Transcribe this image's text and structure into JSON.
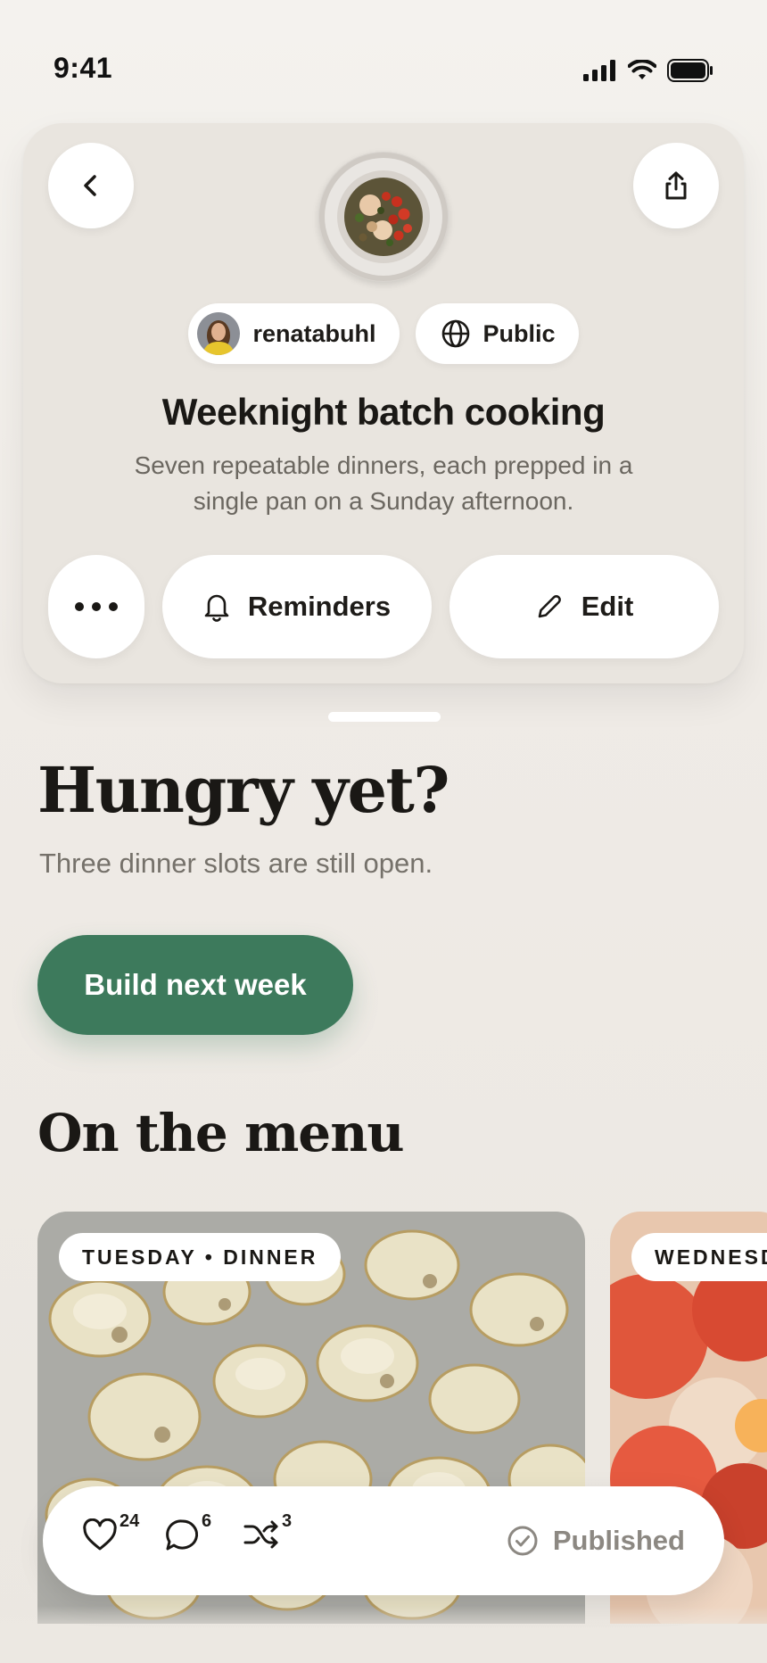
{
  "status_bar": {
    "time": "9:41"
  },
  "header": {
    "author": "renatabuhl",
    "visibility": "Public",
    "title": "Weeknight batch cooking",
    "description": "Seven repeatable dinners, each prepped in a single pan on a Sunday afternoon.",
    "reminders_label": "Reminders",
    "edit_label": "Edit"
  },
  "prompt": {
    "heading": "Hungry yet?",
    "subtext": "Three dinner slots are still open.",
    "cta_label": "Build next week"
  },
  "menu": {
    "heading": "On the menu",
    "cards": [
      {
        "tag": "TUESDAY • DINNER"
      },
      {
        "tag": "WEDNESDAY • DINNER"
      }
    ]
  },
  "stats": {
    "likes": "24",
    "comments": "6",
    "remixes": "3",
    "status": "Published"
  },
  "colors": {
    "accent_green": "#3d7a5c",
    "card_background": "#e9e5df",
    "page_background": "#efebe5"
  }
}
